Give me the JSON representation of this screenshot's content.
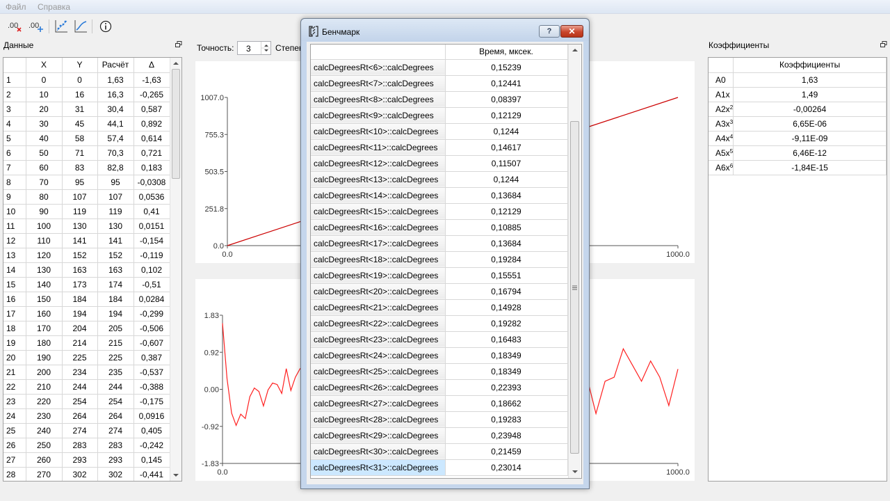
{
  "menu": {
    "file": "Файл",
    "help": "Справка"
  },
  "toolbar": {
    "icons": [
      "add-point-icon",
      "remove-point-icon",
      "scatter-plot-icon",
      "curve-fit-icon",
      "info-icon"
    ]
  },
  "data_panel": {
    "title": "Данные",
    "columns": [
      "X",
      "Y",
      "Расчёт",
      "Δ"
    ],
    "rows": [
      [
        "1",
        "0",
        "0",
        "1,63",
        "-1,63"
      ],
      [
        "2",
        "10",
        "16",
        "16,3",
        "-0,265"
      ],
      [
        "3",
        "20",
        "31",
        "30,4",
        "0,587"
      ],
      [
        "4",
        "30",
        "45",
        "44,1",
        "0,892"
      ],
      [
        "5",
        "40",
        "58",
        "57,4",
        "0,614"
      ],
      [
        "6",
        "50",
        "71",
        "70,3",
        "0,721"
      ],
      [
        "7",
        "60",
        "83",
        "82,8",
        "0,183"
      ],
      [
        "8",
        "70",
        "95",
        "95",
        "-0,0308"
      ],
      [
        "9",
        "80",
        "107",
        "107",
        "0,0536"
      ],
      [
        "10",
        "90",
        "119",
        "119",
        "0,41"
      ],
      [
        "11",
        "100",
        "130",
        "130",
        "0,0151"
      ],
      [
        "12",
        "110",
        "141",
        "141",
        "-0,154"
      ],
      [
        "13",
        "120",
        "152",
        "152",
        "-0,119"
      ],
      [
        "14",
        "130",
        "163",
        "163",
        "0,102"
      ],
      [
        "15",
        "140",
        "173",
        "174",
        "-0,51"
      ],
      [
        "16",
        "150",
        "184",
        "184",
        "0,0284"
      ],
      [
        "17",
        "160",
        "194",
        "194",
        "-0,299"
      ],
      [
        "18",
        "170",
        "204",
        "205",
        "-0,506"
      ],
      [
        "19",
        "180",
        "214",
        "215",
        "-0,607"
      ],
      [
        "20",
        "190",
        "225",
        "225",
        "0,387"
      ],
      [
        "21",
        "200",
        "234",
        "235",
        "-0,537"
      ],
      [
        "22",
        "210",
        "244",
        "244",
        "-0,388"
      ],
      [
        "23",
        "220",
        "254",
        "254",
        "-0,175"
      ],
      [
        "24",
        "230",
        "264",
        "264",
        "0,0916"
      ],
      [
        "25",
        "240",
        "274",
        "274",
        "0,405"
      ],
      [
        "26",
        "250",
        "283",
        "283",
        "-0,242"
      ],
      [
        "27",
        "260",
        "293",
        "293",
        "0,145"
      ],
      [
        "28",
        "270",
        "302",
        "302",
        "-0,441"
      ]
    ]
  },
  "precision": {
    "label": "Точность:",
    "value": "3",
    "degree_label": "Степен"
  },
  "charts": {
    "top": {
      "yticks": [
        "1007.0",
        "755.3",
        "503.5",
        "251.8",
        "0.0"
      ],
      "xticks": [
        "0.0",
        "1000.0"
      ],
      "line_color": "#cc0000"
    },
    "bottom": {
      "yticks": [
        "1.83",
        "0.92",
        "0.00",
        "-0.92",
        "-1.83"
      ],
      "xticks": [
        "0.0",
        "1000.0"
      ],
      "line_color": "#ff2020"
    }
  },
  "chart_data": [
    {
      "type": "line",
      "x": [
        0,
        1000
      ],
      "xlim": [
        0,
        1000
      ],
      "ylim": [
        0,
        1007
      ],
      "series": [
        {
          "values": [
            0,
            1007
          ]
        }
      ]
    },
    {
      "type": "line",
      "xlim": [
        0,
        1000
      ],
      "ylim": [
        -1.83,
        1.83
      ],
      "series": [
        {
          "x": [
            0,
            10,
            20,
            30,
            40,
            50,
            60,
            70,
            80,
            90,
            100,
            110,
            120,
            130,
            140,
            150,
            160,
            170,
            180,
            190,
            200,
            210,
            220,
            230,
            240,
            250,
            260,
            270,
            800,
            820,
            840,
            860,
            880,
            900,
            920,
            940,
            960,
            980,
            1000
          ],
          "values": [
            1.63,
            0.265,
            -0.587,
            -0.892,
            -0.614,
            -0.721,
            -0.183,
            0.0308,
            -0.0536,
            -0.41,
            -0.0151,
            0.154,
            0.119,
            -0.102,
            0.51,
            -0.0284,
            0.299,
            0.506,
            0.607,
            -0.387,
            0.537,
            0.388,
            0.175,
            -0.0916,
            -0.405,
            0.242,
            -0.145,
            0.441,
            0.3,
            -0.6,
            0.2,
            0.3,
            1.0,
            0.6,
            0.2,
            0.7,
            0.3,
            -0.4,
            0.5
          ]
        }
      ]
    }
  ],
  "coef_panel": {
    "title": "Коэффициенты",
    "column": "Коэффициенты",
    "rows": [
      {
        "name": "A0",
        "sup": "",
        "value": "1,63"
      },
      {
        "name": "A1x",
        "sup": "",
        "value": "1,49"
      },
      {
        "name": "A2x",
        "sup": "2",
        "value": "-0,00264"
      },
      {
        "name": "A3x",
        "sup": "3",
        "value": "6,65E-06"
      },
      {
        "name": "A4x",
        "sup": "4",
        "value": "-9,11E-09"
      },
      {
        "name": "A5x",
        "sup": "5",
        "value": "6,46E-12"
      },
      {
        "name": "A6x",
        "sup": "6",
        "value": "-1,84E-15"
      }
    ]
  },
  "dialog": {
    "title": "Бенчмарк",
    "help": "?",
    "close": "✕",
    "column": "Время, мксек.",
    "rows": [
      [
        "calcDegreesRt<6>::calcDegrees",
        "0,15239"
      ],
      [
        "calcDegreesRt<7>::calcDegrees",
        "0,12441"
      ],
      [
        "calcDegreesRt<8>::calcDegrees",
        "0,08397"
      ],
      [
        "calcDegreesRt<9>::calcDegrees",
        "0,12129"
      ],
      [
        "calcDegreesRt<10>::calcDegrees",
        "0,1244"
      ],
      [
        "calcDegreesRt<11>::calcDegrees",
        "0,14617"
      ],
      [
        "calcDegreesRt<12>::calcDegrees",
        "0,11507"
      ],
      [
        "calcDegreesRt<13>::calcDegrees",
        "0,1244"
      ],
      [
        "calcDegreesRt<14>::calcDegrees",
        "0,13684"
      ],
      [
        "calcDegreesRt<15>::calcDegrees",
        "0,12129"
      ],
      [
        "calcDegreesRt<16>::calcDegrees",
        "0,10885"
      ],
      [
        "calcDegreesRt<17>::calcDegrees",
        "0,13684"
      ],
      [
        "calcDegreesRt<18>::calcDegrees",
        "0,19284"
      ],
      [
        "calcDegreesRt<19>::calcDegrees",
        "0,15551"
      ],
      [
        "calcDegreesRt<20>::calcDegrees",
        "0,16794"
      ],
      [
        "calcDegreesRt<21>::calcDegrees",
        "0,14928"
      ],
      [
        "calcDegreesRt<22>::calcDegrees",
        "0,19282"
      ],
      [
        "calcDegreesRt<23>::calcDegrees",
        "0,16483"
      ],
      [
        "calcDegreesRt<24>::calcDegrees",
        "0,18349"
      ],
      [
        "calcDegreesRt<25>::calcDegrees",
        "0,18349"
      ],
      [
        "calcDegreesRt<26>::calcDegrees",
        "0,22393"
      ],
      [
        "calcDegreesRt<27>::calcDegrees",
        "0,18662"
      ],
      [
        "calcDegreesRt<28>::calcDegrees",
        "0,19283"
      ],
      [
        "calcDegreesRt<29>::calcDegrees",
        "0,23948"
      ],
      [
        "calcDegreesRt<30>::calcDegrees",
        "0,21459"
      ],
      [
        "calcDegreesRt<31>::calcDegrees",
        "0,23014"
      ]
    ],
    "selected_row": 25
  }
}
